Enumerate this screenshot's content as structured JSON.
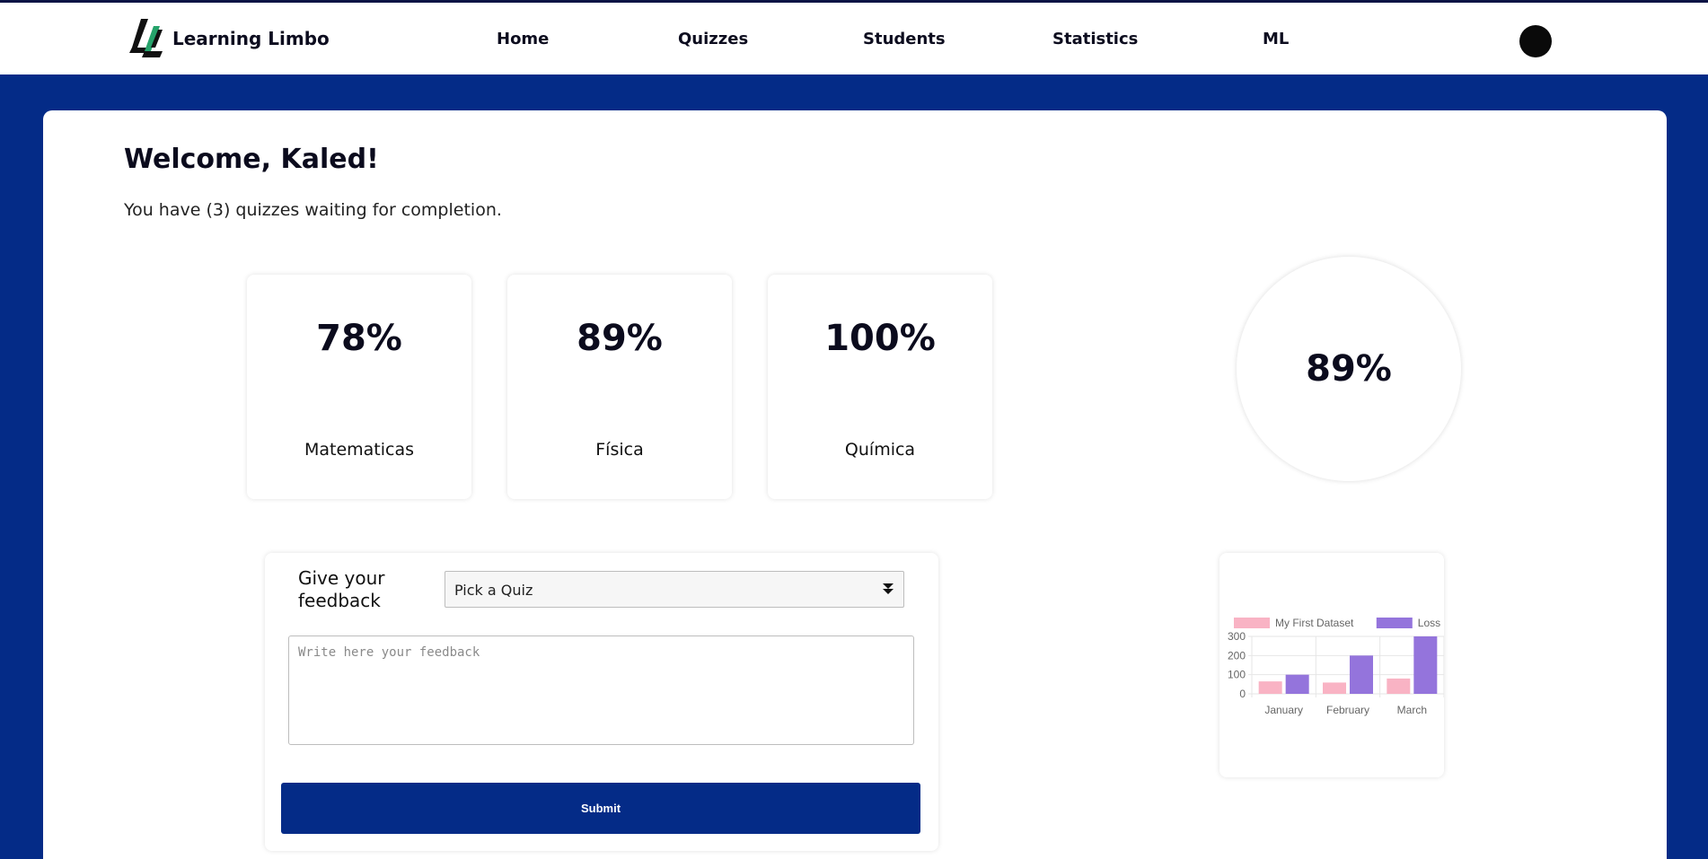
{
  "nav": {
    "brand": "Learning Limbo",
    "links": [
      "Home",
      "Quizzes",
      "Students",
      "Statistics",
      "ML"
    ]
  },
  "main": {
    "welcome": "Welcome, Kaled!",
    "subtext": "You have (3) quizzes waiting for completion.",
    "cards": [
      {
        "percent": "78%",
        "subject": "Matematicas"
      },
      {
        "percent": "89%",
        "subject": "Física"
      },
      {
        "percent": "100%",
        "subject": "Química"
      }
    ],
    "overall": "89%"
  },
  "feedback": {
    "label": "Give your feedback",
    "select_value": "Pick a Quiz",
    "textarea_placeholder": "Write here your feedback",
    "submit_label": "Submit"
  },
  "chart_data": {
    "type": "bar",
    "categories": [
      "January",
      "February",
      "March"
    ],
    "series": [
      {
        "name": "My First Dataset",
        "values": [
          65,
          59,
          80
        ],
        "color": "#f9b3c4"
      },
      {
        "name": "Loss",
        "values": [
          100,
          200,
          300
        ],
        "color": "#9474dc"
      }
    ],
    "y_ticks": [
      "0",
      "100",
      "200",
      "300"
    ],
    "ylim": [
      0,
      300
    ],
    "legend": "top",
    "grid": true
  },
  "colors": {
    "primary": "#042b87",
    "accent": "#26a36b"
  }
}
